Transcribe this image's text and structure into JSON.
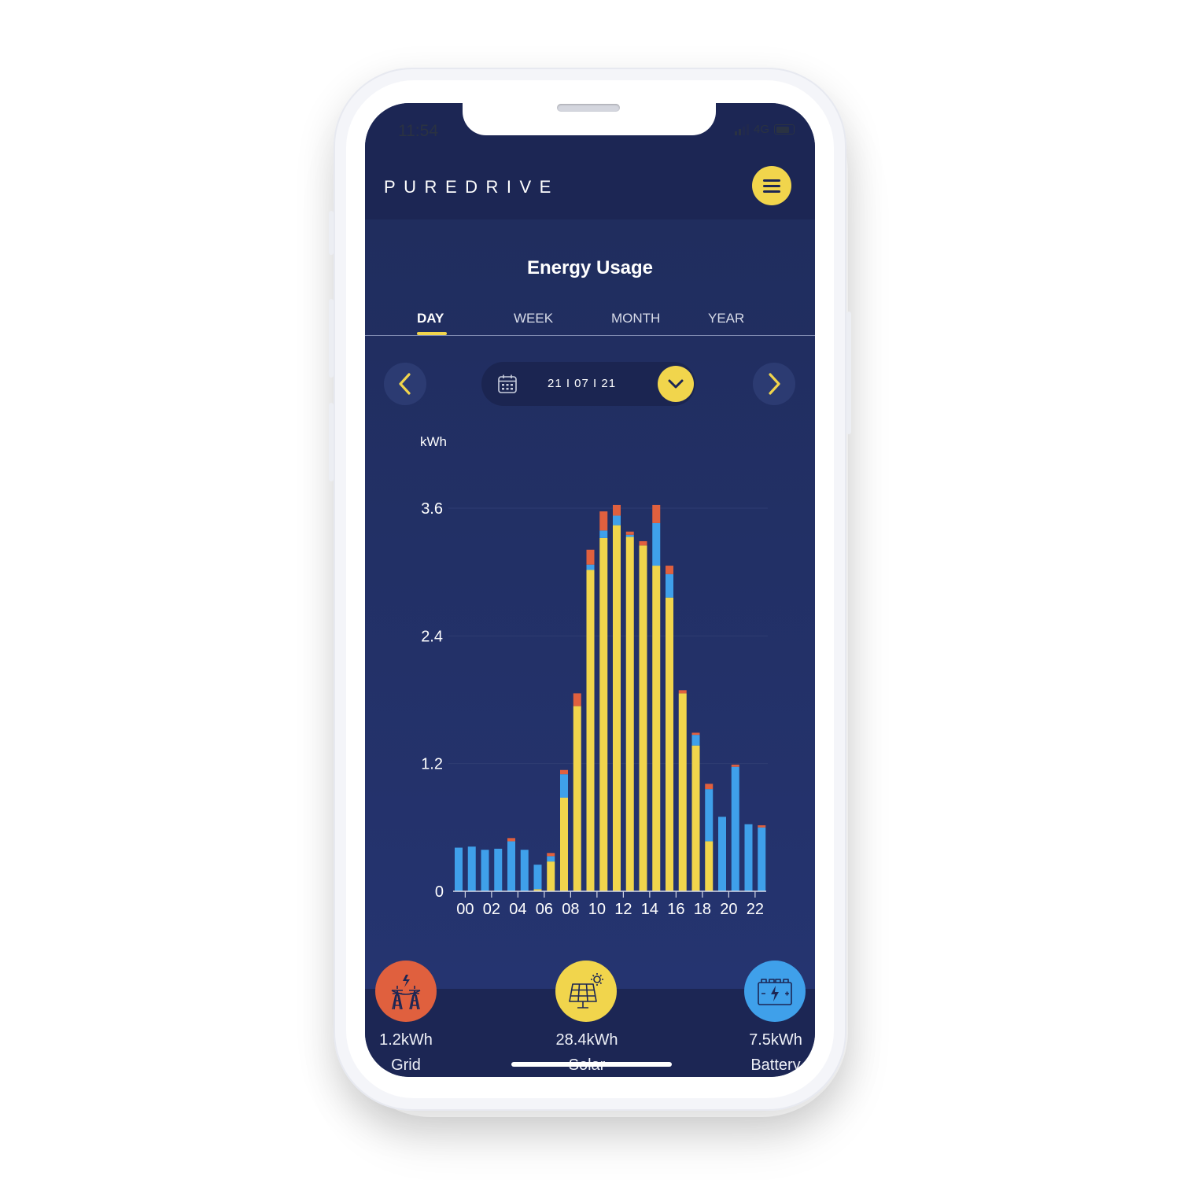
{
  "status_bar": {
    "time": "11:54",
    "network": "4G"
  },
  "header": {
    "logo": "PUREDRIVE",
    "menu_icon": "hamburger-menu-icon"
  },
  "page": {
    "title": "Energy Usage"
  },
  "tabs": [
    {
      "label": "DAY",
      "active": true
    },
    {
      "label": "WEEK",
      "active": false
    },
    {
      "label": "MONTH",
      "active": false
    },
    {
      "label": "YEAR",
      "active": false
    }
  ],
  "date_selector": {
    "date": "21 I 07 I 21",
    "prev_icon": "chevron-left-icon",
    "next_icon": "chevron-right-icon",
    "calendar_icon": "calendar-icon",
    "dropdown_icon": "chevron-down-icon"
  },
  "colors": {
    "solar": "#f1d54c",
    "battery": "#3fa0ea",
    "grid": "#e0603e",
    "background": "#1d2a5a"
  },
  "chart_data": {
    "type": "bar",
    "stacked": true,
    "ylabel": "kWh",
    "ylim": [
      0,
      3.6
    ],
    "yticks": [
      "3.6",
      "2.4",
      "1.2",
      "0"
    ],
    "tick_values": [
      3.6,
      2.4,
      1.2,
      0
    ],
    "xtick_labels": [
      "00",
      "02",
      "04",
      "06",
      "08",
      "10",
      "12",
      "14",
      "16",
      "18",
      "20",
      "22"
    ],
    "categories": [
      "00",
      "01",
      "02",
      "03",
      "04",
      "05",
      "06",
      "07",
      "08",
      "09",
      "10",
      "11",
      "12",
      "13",
      "14",
      "15",
      "16",
      "17",
      "18",
      "19",
      "20",
      "21",
      "22",
      "23"
    ],
    "series": [
      {
        "color": "#f1d54c",
        "values": [
          0,
          0,
          0,
          0,
          0,
          0,
          0.02,
          0.28,
          0.88,
          1.74,
          3.02,
          3.32,
          3.44,
          3.33,
          3.25,
          3.06,
          2.76,
          1.86,
          1.37,
          0.47,
          0,
          0,
          0,
          0
        ]
      },
      {
        "color": "#3fa0ea",
        "values": [
          0.41,
          0.42,
          0.39,
          0.4,
          0.47,
          0.39,
          0.23,
          0.05,
          0.22,
          0,
          0.05,
          0.07,
          0.09,
          0.02,
          0,
          0.4,
          0.22,
          0,
          0.1,
          0.49,
          0.7,
          1.17,
          0.63,
          0.6
        ]
      },
      {
        "color": "#e0603e",
        "values": [
          0,
          0,
          0,
          0,
          0.03,
          0,
          0,
          0.03,
          0.04,
          0.12,
          0.14,
          0.18,
          0.1,
          0.03,
          0.04,
          0.17,
          0.08,
          0.03,
          0.02,
          0.05,
          0,
          0.02,
          0,
          0.02
        ]
      }
    ]
  },
  "summary": [
    {
      "value": "1.2kWh",
      "label": "Grid",
      "icon": "power-tower-icon",
      "color": "#e0603e"
    },
    {
      "value": "28.4kWh",
      "label": "Solar",
      "icon": "solar-panel-icon",
      "color": "#f1d54c"
    },
    {
      "value": "7.5kWh",
      "label": "Battery",
      "icon": "battery-icon",
      "color": "#3fa0ea"
    }
  ]
}
